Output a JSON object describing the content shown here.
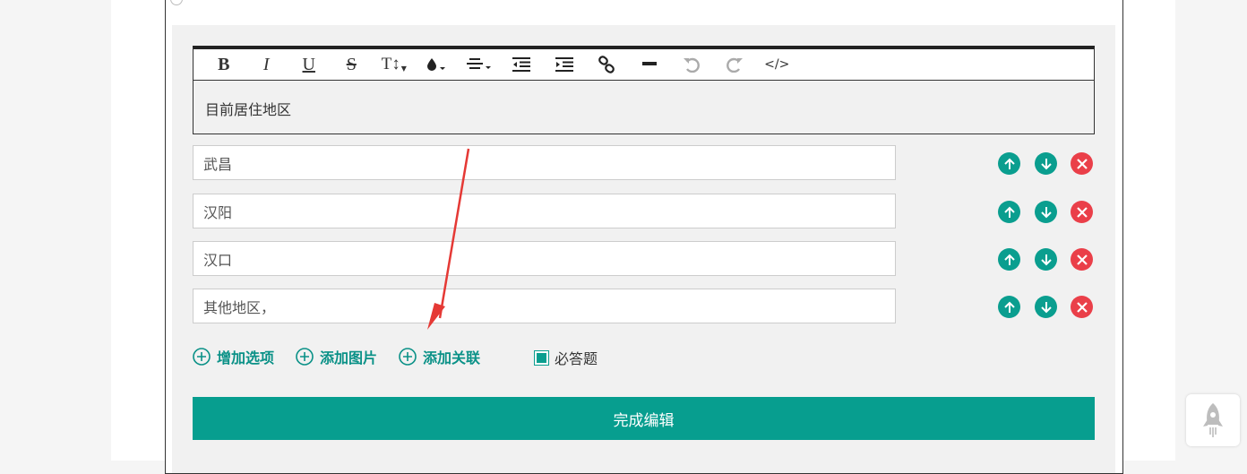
{
  "toolbar": {
    "items": [
      {
        "label": "B",
        "icon": "bold-icon"
      },
      {
        "label": "I",
        "icon": "italic-icon"
      },
      {
        "label": "U",
        "icon": "underline-icon"
      },
      {
        "label": "S",
        "icon": "strikethrough-icon"
      },
      {
        "label": "T↕",
        "icon": "font-size-icon"
      },
      {
        "label": "",
        "icon": "text-color-icon"
      },
      {
        "label": "",
        "icon": "align-icon"
      },
      {
        "label": "",
        "icon": "indent-decrease-icon"
      },
      {
        "label": "",
        "icon": "indent-increase-icon"
      },
      {
        "label": "",
        "icon": "link-icon"
      },
      {
        "label": "",
        "icon": "horizontal-rule-icon"
      },
      {
        "label": "",
        "icon": "undo-icon"
      },
      {
        "label": "",
        "icon": "redo-icon"
      },
      {
        "label": "</>",
        "icon": "code-icon"
      }
    ]
  },
  "question": {
    "title": "目前居住地区"
  },
  "options": [
    {
      "value": "武昌"
    },
    {
      "value": "汉阳"
    },
    {
      "value": "汉口"
    },
    {
      "value": "其他地区，"
    }
  ],
  "actions": {
    "add_option": "增加选项",
    "add_image": "添加图片",
    "add_relation": "添加关联",
    "required": "必答题"
  },
  "finish_label": "完成编辑",
  "colors": {
    "teal": "#0a9e8f",
    "red": "#ea3f49",
    "annotation_arrow": "#e53935"
  }
}
